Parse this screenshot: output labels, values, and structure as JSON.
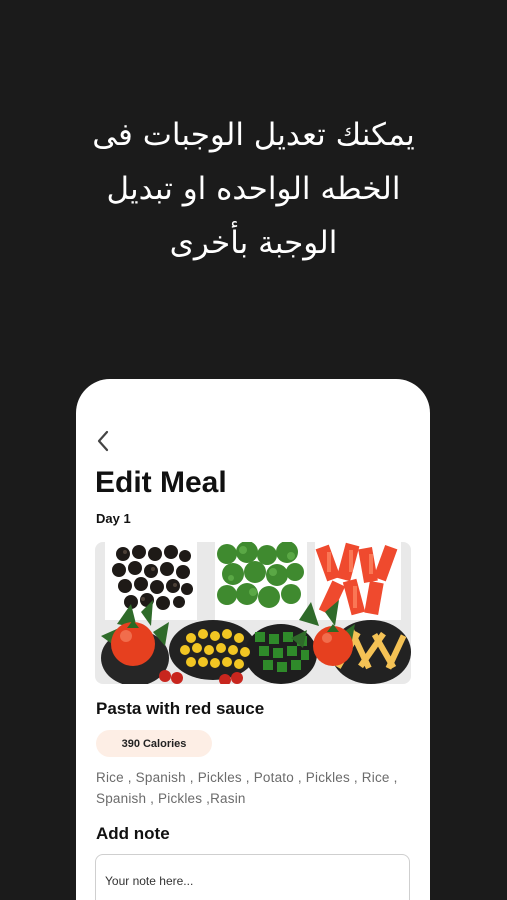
{
  "promo": {
    "text": "يمكنك تعديل الوجبات فى\nالخطه الواحده او تبديل\nالوجبة بأخرى"
  },
  "screen": {
    "title": "Edit Meal",
    "day": "Day 1",
    "back_icon": "chevron-left-icon"
  },
  "meal": {
    "name": "Pasta with red sauce",
    "calories": "390 Calories",
    "ingredients": "Rice , Spanish , Pickles , Potato , Pickles , Rice , Spanish , Pickles ,Rasin"
  },
  "note": {
    "label": "Add note",
    "placeholder": "Your note here..."
  },
  "colors": {
    "background": "#1b1b1b",
    "card": "#ffffff",
    "calorie_badge": "#fdeee5"
  }
}
